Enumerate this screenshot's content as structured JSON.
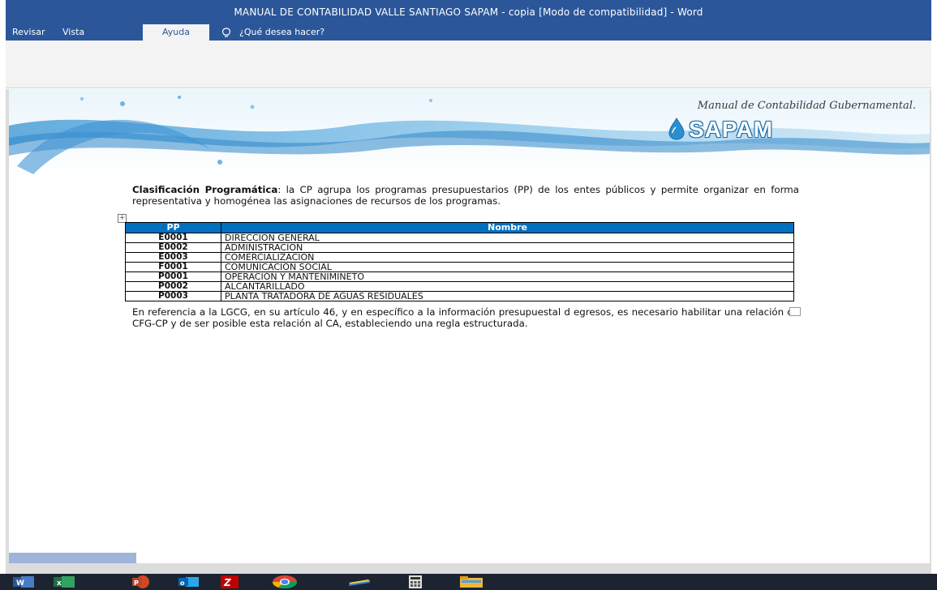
{
  "window": {
    "title": "MANUAL DE CONTABILIDAD VALLE SANTIAGO SAPAM - copia [Modo de compatibilidad] - Word"
  },
  "ribbon": {
    "tabs": [
      "Revisar",
      "Vista",
      "Ayuda"
    ],
    "active_tab": "Ayuda",
    "search_placeholder": "¿Qué desea hacer?",
    "search_icon": "lightbulb-icon"
  },
  "document": {
    "header_title": "Manual de Contabilidad Gubernamental.",
    "logo_text": "SAPAM",
    "para1_bold": "Clasificación Programática",
    "para1_rest": ": la CP agrupa los programas presupuestarios (PP) de los entes públicos y permite organizar en forma representativa y homogénea las asignaciones de recursos de los programas.",
    "table": {
      "headers": [
        "PP",
        "Nombre"
      ],
      "rows": [
        [
          "E0001",
          "DIRECCION GENERAL"
        ],
        [
          "E0002",
          "ADMINISTRACION"
        ],
        [
          "E0003",
          "COMERCIALIZACION"
        ],
        [
          "F0001",
          "COMUNICACIÓN SOCIAL"
        ],
        [
          "P0001",
          "OPERACIÓN Y MANTENIMINETO"
        ],
        [
          "P0002",
          "ALCANTARILLADO"
        ],
        [
          "P0003",
          "PLANTA TRATADORA DE AGUAS RESIDUALES"
        ]
      ]
    },
    "para2": "En referencia a la LGCG, en su artículo 46, y en específico a la información presupuestal d egresos, es necesario habilitar una relación de CFG-CP y de ser posible esta relación al CA, estableciendo una regla estructurada."
  },
  "taskbar": {
    "apps": [
      "word-icon",
      "excel-icon",
      "powerpoint-icon",
      "outlook-icon",
      "filezilla-icon",
      "chrome-icon",
      "file-explorer-icon",
      "calculator-icon",
      "folder-icon"
    ]
  }
}
